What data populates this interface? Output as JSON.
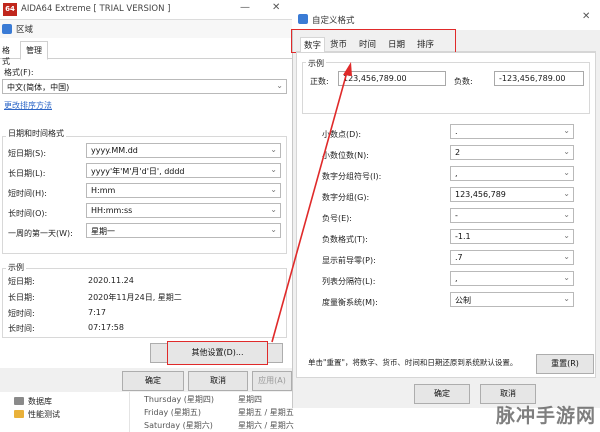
{
  "aida": {
    "logo": "64",
    "title": "AIDA64 Extreme  [ TRIAL VERSION ]"
  },
  "region": {
    "title": "区域",
    "tabs": [
      "格式",
      "管理"
    ],
    "format_label": "格式(F):",
    "format_value": "中文(简体，中国)",
    "sort_link": "更改排序方法",
    "datetime_group": "日期和时间格式",
    "rows": [
      {
        "label": "短日期(S):",
        "value": "yyyy.MM.dd"
      },
      {
        "label": "长日期(L):",
        "value": "yyyy'年'M'月'd'日', dddd"
      },
      {
        "label": "短时间(H):",
        "value": "H:mm"
      },
      {
        "label": "长时间(O):",
        "value": "HH:mm:ss"
      },
      {
        "label": "一周的第一天(W):",
        "value": "星期一"
      }
    ],
    "example_group": "示例",
    "examples": [
      {
        "label": "短日期:",
        "value": "2020.11.24"
      },
      {
        "label": "长日期:",
        "value": "2020年11月24日, 星期二"
      },
      {
        "label": "短时间:",
        "value": "7:17"
      },
      {
        "label": "长时间:",
        "value": "07:17:58"
      }
    ],
    "other_settings": "其他设置(D)...",
    "ok": "确定",
    "cancel": "取消",
    "apply": "应用(A)"
  },
  "explorer": {
    "items": [
      "数据库",
      "性能测试"
    ],
    "list": [
      {
        "name": "Thursday (星期四)",
        "value": "星期四"
      },
      {
        "name": "Friday (星期五)",
        "value": "星期五 / 星期五"
      },
      {
        "name": "Saturday (星期六)",
        "value": "星期六 / 星期六"
      }
    ]
  },
  "custom": {
    "title": "自定义格式",
    "tabs": [
      "数字",
      "货币",
      "时间",
      "日期",
      "排序"
    ],
    "example": "示例",
    "positive_label": "正数:",
    "positive_value": "123,456,789.00",
    "negative_label": "负数:",
    "negative_value": "-123,456,789.00",
    "rows": [
      {
        "label": "小数点(D):",
        "value": "."
      },
      {
        "label": "小数位数(N):",
        "value": "2"
      },
      {
        "label": "数字分组符号(I):",
        "value": ","
      },
      {
        "label": "数字分组(G):",
        "value": "123,456,789"
      },
      {
        "label": "负号(E):",
        "value": "-"
      },
      {
        "label": "负数格式(T):",
        "value": "-1.1"
      },
      {
        "label": "显示前导零(P):",
        "value": ".7"
      },
      {
        "label": "列表分隔符(L):",
        "value": ","
      },
      {
        "label": "度量衡系统(M):",
        "value": "公制"
      }
    ],
    "note": "单击\"重置\"，将数字、货币、时间和日期还原到系统默认设置。",
    "reset": "重置(R)",
    "ok": "确定",
    "cancel": "取消"
  },
  "watermark": "脉冲手游网",
  "colors": {
    "highlight": "#e02a2a",
    "link": "#2b65c7"
  }
}
